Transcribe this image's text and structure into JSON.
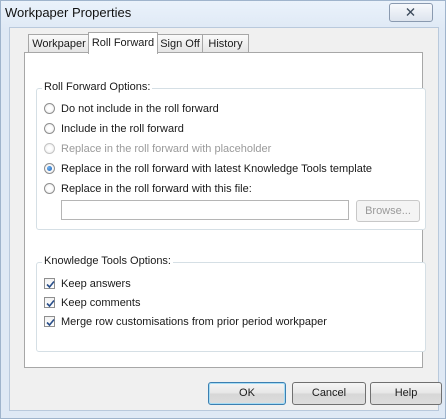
{
  "window": {
    "title": "Workpaper Properties"
  },
  "tabs": [
    {
      "label": "Workpaper",
      "active": false
    },
    {
      "label": "Roll Forward",
      "active": true
    },
    {
      "label": "Sign Off",
      "active": false
    },
    {
      "label": "History",
      "active": false
    }
  ],
  "roll_forward": {
    "group_label": "Roll Forward Options:",
    "options": [
      {
        "label": "Do not include in the roll forward",
        "selected": false,
        "enabled": true
      },
      {
        "label": "Include in the roll forward",
        "selected": false,
        "enabled": true
      },
      {
        "label": "Replace in the roll forward with placeholder",
        "selected": false,
        "enabled": false
      },
      {
        "label": "Replace in the roll forward with latest Knowledge Tools template",
        "selected": true,
        "enabled": true
      },
      {
        "label": "Replace in the roll forward with this file:",
        "selected": false,
        "enabled": true
      }
    ],
    "file_value": "",
    "browse_label": "Browse..."
  },
  "knowledge_tools": {
    "group_label": "Knowledge Tools Options:",
    "options": [
      {
        "label": "Keep answers",
        "checked": true
      },
      {
        "label": "Keep comments",
        "checked": true
      },
      {
        "label": "Merge row customisations from prior period workpaper",
        "checked": true
      }
    ]
  },
  "footer": {
    "ok_label": "OK",
    "cancel_label": "Cancel",
    "help_label": "Help"
  }
}
